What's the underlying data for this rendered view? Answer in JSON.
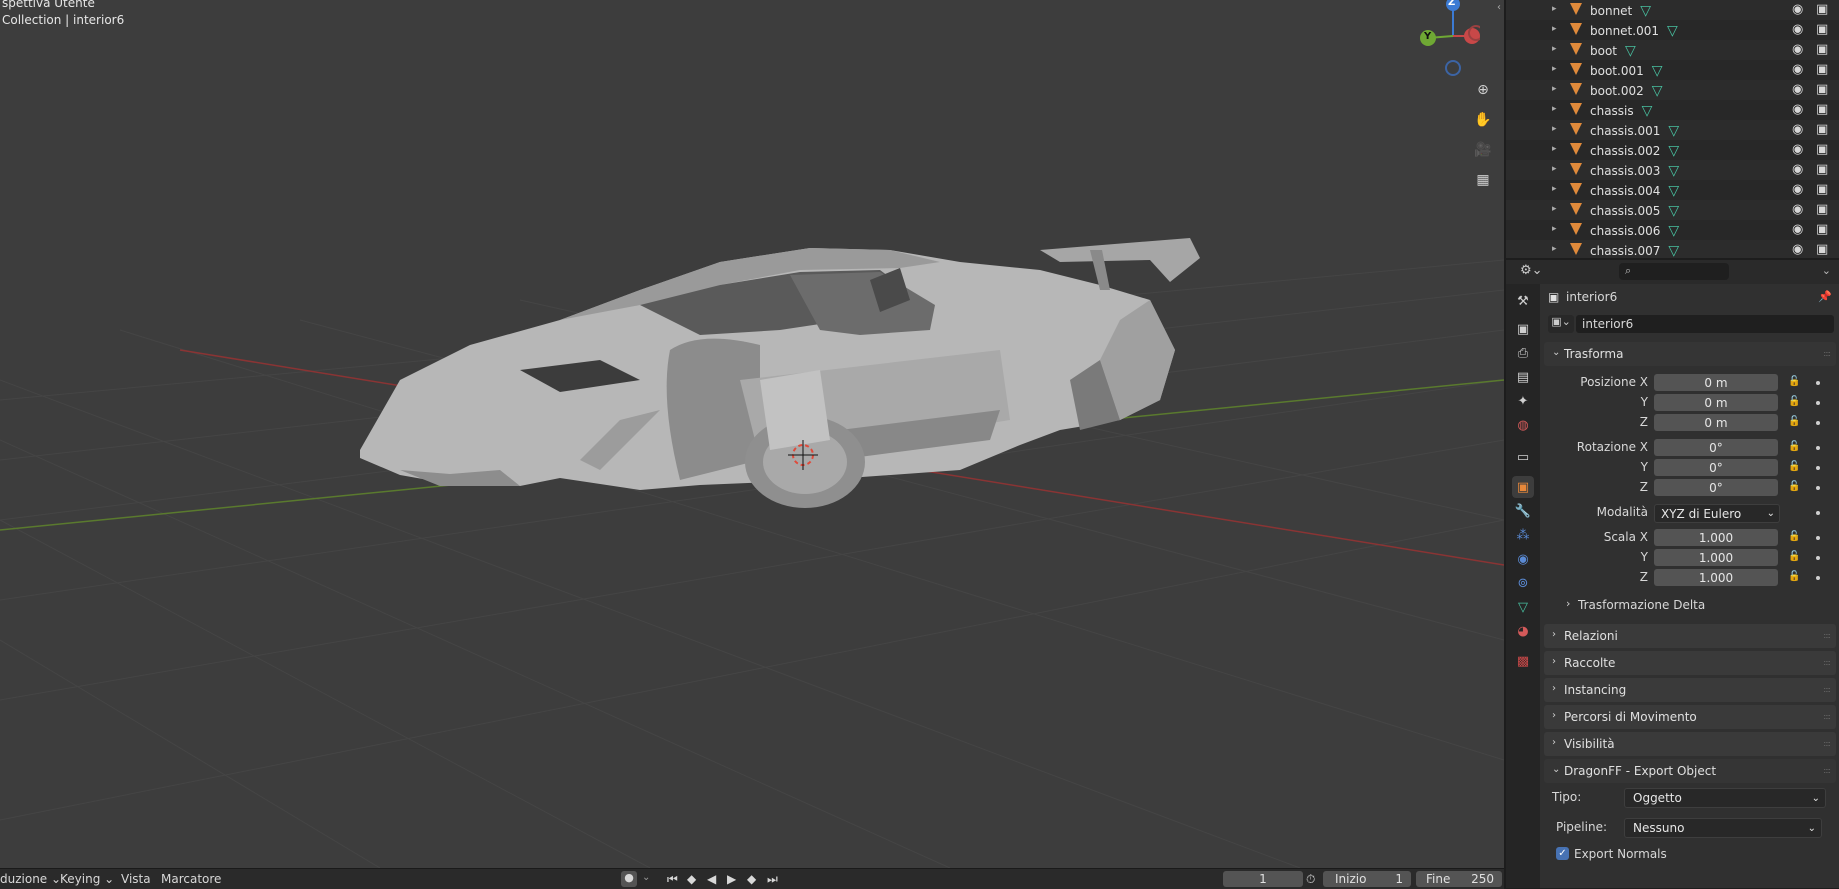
{
  "viewport": {
    "view_name": "spettiva Utente",
    "collection_info": "Collection | interior6"
  },
  "navigation_gizmo": {
    "axis_z": "Z",
    "axis_y": "Y"
  },
  "timeline": {
    "mode_menu": "duzione",
    "keying_menu": "Keying",
    "view_menu": "Vista",
    "marker_menu": "Marcatore",
    "current_frame": "1",
    "start_label": "Inizio",
    "start_value": "1",
    "end_label": "Fine",
    "end_value": "250"
  },
  "outliner": {
    "items": [
      {
        "name": "bonnet"
      },
      {
        "name": "bonnet.001"
      },
      {
        "name": "boot"
      },
      {
        "name": "boot.001"
      },
      {
        "name": "boot.002"
      },
      {
        "name": "chassis"
      },
      {
        "name": "chassis.001"
      },
      {
        "name": "chassis.002"
      },
      {
        "name": "chassis.003"
      },
      {
        "name": "chassis.004"
      },
      {
        "name": "chassis.005"
      },
      {
        "name": "chassis.006"
      },
      {
        "name": "chassis.007"
      }
    ]
  },
  "properties": {
    "object_name": "interior6",
    "object_field": "interior6",
    "transform": {
      "title": "Trasforma",
      "position_label": "Posizione X",
      "pos_x": "0 m",
      "pos_y": "0 m",
      "pos_z": "0 m",
      "rotation_label": "Rotazione X",
      "rot_x": "0°",
      "rot_y": "0°",
      "rot_z": "0°",
      "mode_label": "Modalità",
      "mode_value": "XYZ di Eulero",
      "scale_label": "Scala X",
      "scale_x": "1.000",
      "scale_y": "1.000",
      "scale_z": "1.000",
      "y_label": "Y",
      "z_label": "Z",
      "delta": "Trasformazione Delta"
    },
    "panels": {
      "relations": "Relazioni",
      "collections": "Raccolte",
      "instancing": "Instancing",
      "motion_paths": "Percorsi di Movimento",
      "visibility": "Visibilità",
      "dragonff": "DragonFF - Export Object"
    },
    "dragonff": {
      "type_label": "Tipo:",
      "type_value": "Oggetto",
      "pipeline_label": "Pipeline:",
      "pipeline_value": "Nessuno",
      "export_normals": "Export Normals"
    }
  }
}
